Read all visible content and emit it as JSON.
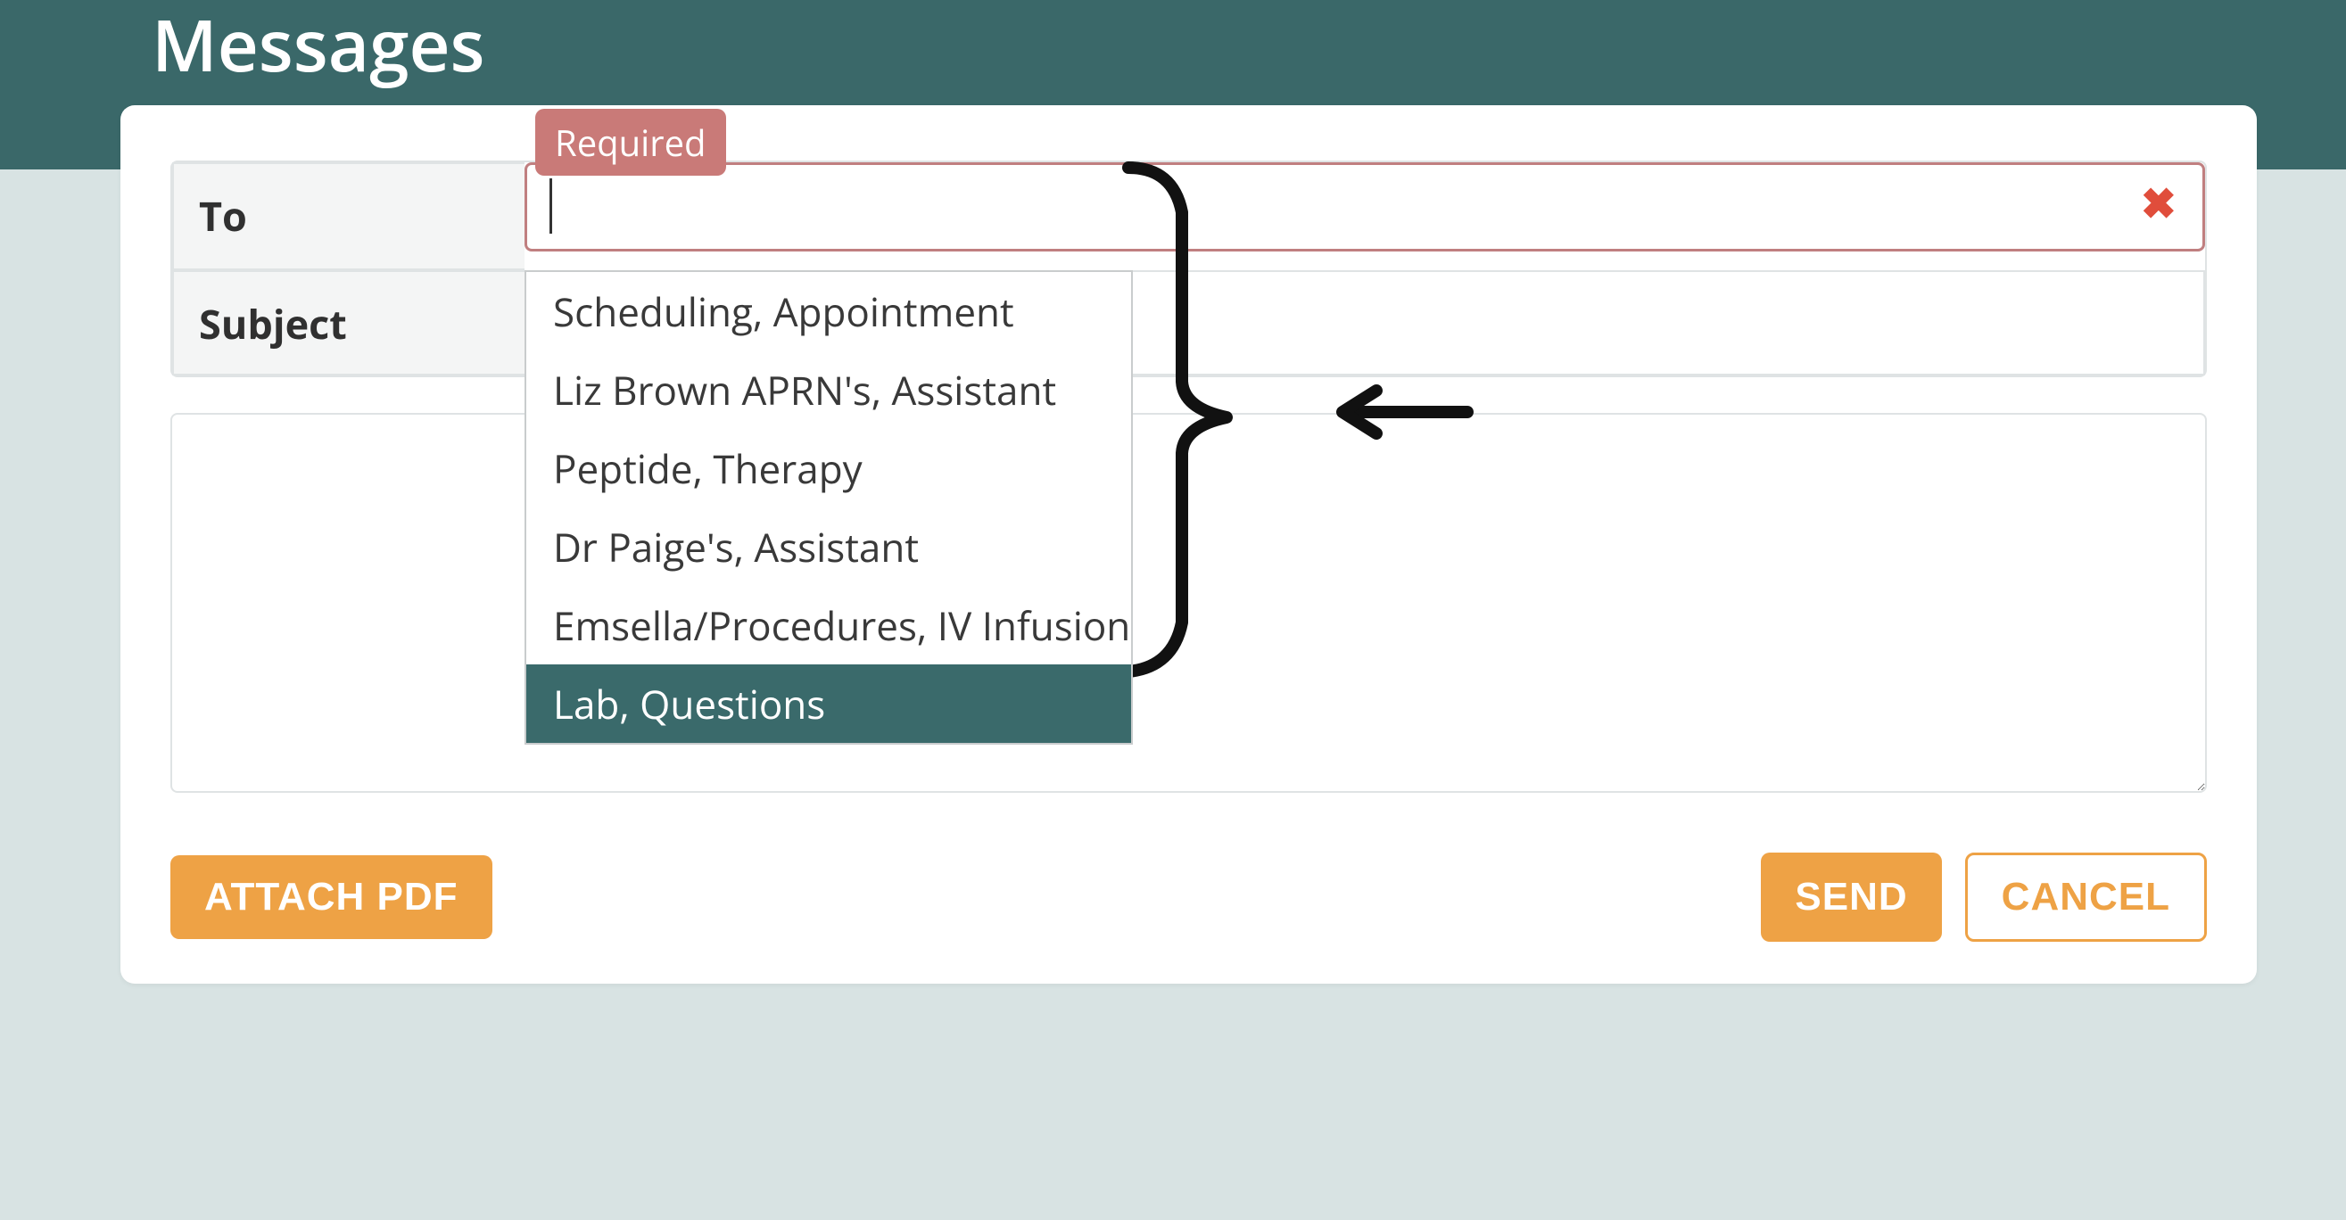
{
  "page_title": "Messages",
  "required_label": "Required",
  "labels": {
    "to": "To",
    "subject": "Subject"
  },
  "to_value": "",
  "subject_value": "",
  "body_value": "",
  "dropdown_options": [
    {
      "label": "Scheduling, Appointment",
      "selected": false
    },
    {
      "label": "Liz Brown APRN's, Assistant",
      "selected": false
    },
    {
      "label": "Peptide, Therapy",
      "selected": false
    },
    {
      "label": "Dr Paige's, Assistant",
      "selected": false
    },
    {
      "label": "Emsella/Procedures, IV Infusion",
      "selected": false
    },
    {
      "label": "Lab, Questions",
      "selected": true
    }
  ],
  "buttons": {
    "attach": "ATTACH PDF",
    "send": "SEND",
    "cancel": "CANCEL"
  },
  "clear_icon_title": "Clear"
}
